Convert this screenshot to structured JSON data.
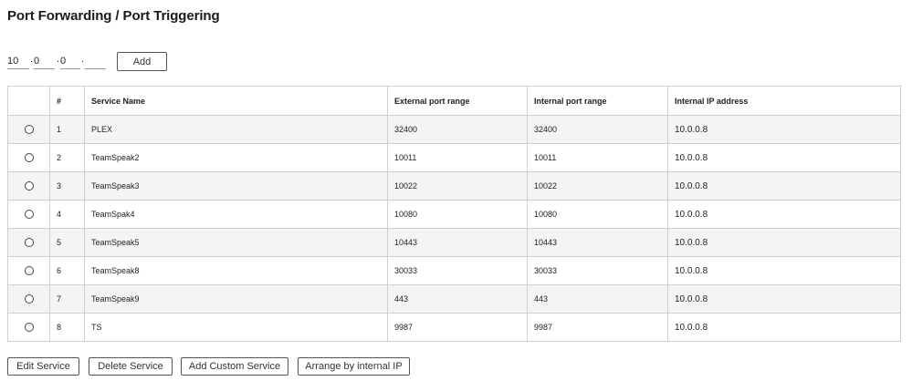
{
  "page": {
    "title": "Port Forwarding / Port Triggering"
  },
  "ip_entry": {
    "octets": [
      "10",
      "0",
      "0",
      ""
    ],
    "add_label": "Add"
  },
  "table": {
    "headers": [
      "",
      "#",
      "Service Name",
      "External port range",
      "Internal port range",
      "Internal IP address"
    ],
    "rows": [
      {
        "num": "1",
        "service": "PLEX",
        "external": "32400",
        "internal": "32400",
        "ip": "10.0.0.8"
      },
      {
        "num": "2",
        "service": "TeamSpeak2",
        "external": "10011",
        "internal": "10011",
        "ip": "10.0.0.8"
      },
      {
        "num": "3",
        "service": "TeamSpeak3",
        "external": "10022",
        "internal": "10022",
        "ip": "10.0.0.8"
      },
      {
        "num": "4",
        "service": "TeamSpak4",
        "external": "10080",
        "internal": "10080",
        "ip": "10.0.0.8"
      },
      {
        "num": "5",
        "service": "TeamSpeak5",
        "external": "10443",
        "internal": "10443",
        "ip": "10.0.0.8"
      },
      {
        "num": "6",
        "service": "TeamSpeak8",
        "external": "30033",
        "internal": "30033",
        "ip": "10.0.0.8"
      },
      {
        "num": "7",
        "service": "TeamSpeak9",
        "external": "443",
        "internal": "443",
        "ip": "10.0.0.8"
      },
      {
        "num": "8",
        "service": "TS",
        "external": "9987",
        "internal": "9987",
        "ip": "10.0.0.8"
      }
    ]
  },
  "actions": {
    "edit": "Edit Service",
    "delete": "Delete Service",
    "add_custom": "Add Custom Service",
    "arrange": "Arrange by internal IP"
  }
}
